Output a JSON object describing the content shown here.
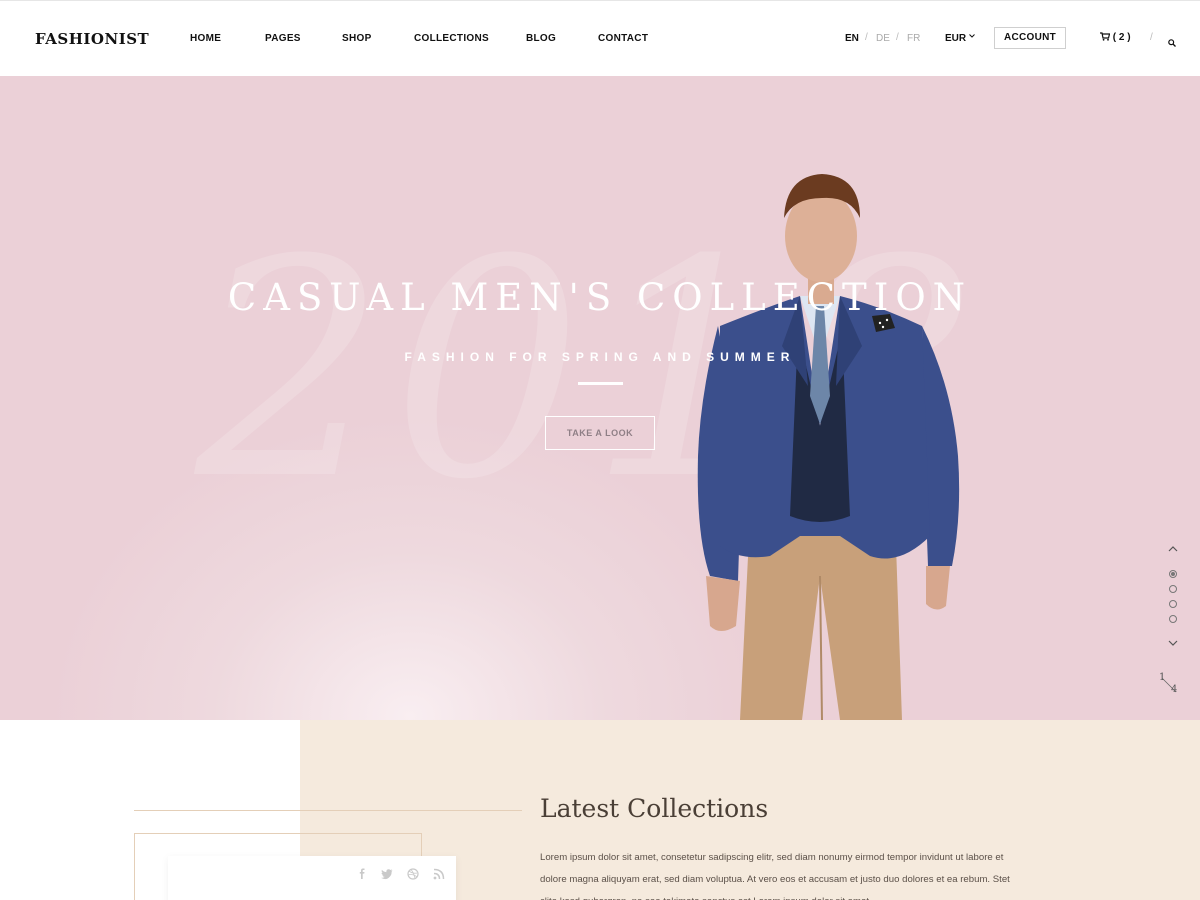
{
  "header": {
    "logo": "FASHIONIST",
    "nav": [
      "HOME",
      "PAGES",
      "SHOP",
      "COLLECTIONS",
      "BLOG",
      "CONTACT"
    ],
    "languages": [
      "EN",
      "DE",
      "FR"
    ],
    "language_separator": "/",
    "currency": "EUR",
    "account_label": "ACCOUNT",
    "cart_count": "( 2 )",
    "search_separator": "/"
  },
  "hero": {
    "background_number": "2018",
    "title": "CASUAL MEN'S COLLECTION",
    "subtitle": "FASHION FOR SPRING AND SUMMER",
    "button_label": "TAKE A LOOK",
    "slide_current": "1",
    "slide_total": "4",
    "active_slide": 1,
    "colors": {
      "background": "#ebd0d7",
      "jacket": "#3b4f8c",
      "pants": "#c8a07a"
    }
  },
  "latest": {
    "title": "Latest Collections",
    "text": "Lorem ipsum dolor sit amet, consetetur sadipscing elitr, sed diam nonumy eirmod tempor invidunt ut labore et dolore magna aliquyam erat, sed diam voluptua. At vero eos et accusam et justo duo dolores et ea rebum. Stet clita kasd gubergren, no sea takimata sanctus est Lorem ipsum dolor sit amet."
  },
  "social_icons": [
    "facebook-icon",
    "twitter-icon",
    "dribbble-icon",
    "rss-icon"
  ],
  "colors": {
    "beige": "#f5eadd",
    "accent_line": "#e4cfb8"
  }
}
